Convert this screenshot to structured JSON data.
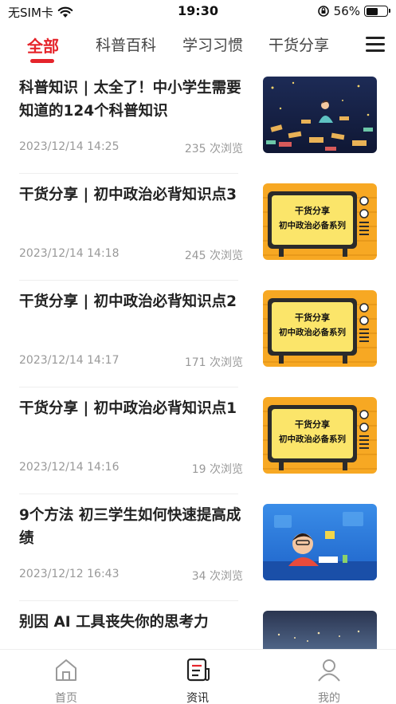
{
  "status_bar": {
    "carrier": "无SIM卡",
    "time": "19:30",
    "battery": "56%",
    "battery_level": 0.56
  },
  "tabs": [
    {
      "label": "全部",
      "active": true
    },
    {
      "label": "科普百科"
    },
    {
      "label": "学习习惯"
    },
    {
      "label": "干货分享"
    }
  ],
  "articles": [
    {
      "title": "科普知识 | 太全了！中小学生需要知道的124个科普知识",
      "date": "2023/12/14 14:25",
      "views": "235 次浏览",
      "thumb": "night-stars"
    },
    {
      "title": "干货分享 | 初中政治必背知识点3",
      "date": "2023/12/14 14:18",
      "views": "245 次浏览",
      "thumb": "tv",
      "tv_line1": "干货分享",
      "tv_line2": "初中政治必备系列"
    },
    {
      "title": "干货分享 | 初中政治必背知识点2",
      "date": "2023/12/14 14:17",
      "views": "171 次浏览",
      "thumb": "tv",
      "tv_line1": "干货分享",
      "tv_line2": "初中政治必备系列"
    },
    {
      "title": "干货分享  | 初中政治必背知识点1",
      "date": "2023/12/14 14:16",
      "views": "19 次浏览",
      "thumb": "tv",
      "tv_line1": "干货分享",
      "tv_line2": "初中政治必备系列"
    },
    {
      "title": "9个方法 初三学生如何快速提高成绩",
      "date": "2023/12/12 16:43",
      "views": "34 次浏览",
      "thumb": "student"
    },
    {
      "title": "别因 AI 工具丧失你的思考力",
      "date": "",
      "views": "",
      "thumb": "city"
    }
  ],
  "tabbar": [
    {
      "label": "首页",
      "icon": "home-icon"
    },
    {
      "label": "资讯",
      "icon": "news-icon",
      "active": true
    },
    {
      "label": "我的",
      "icon": "profile-icon"
    }
  ],
  "colors": {
    "accent": "#e5242b",
    "tv_body": "#f7a823",
    "tv_screen": "#fbe56a"
  }
}
